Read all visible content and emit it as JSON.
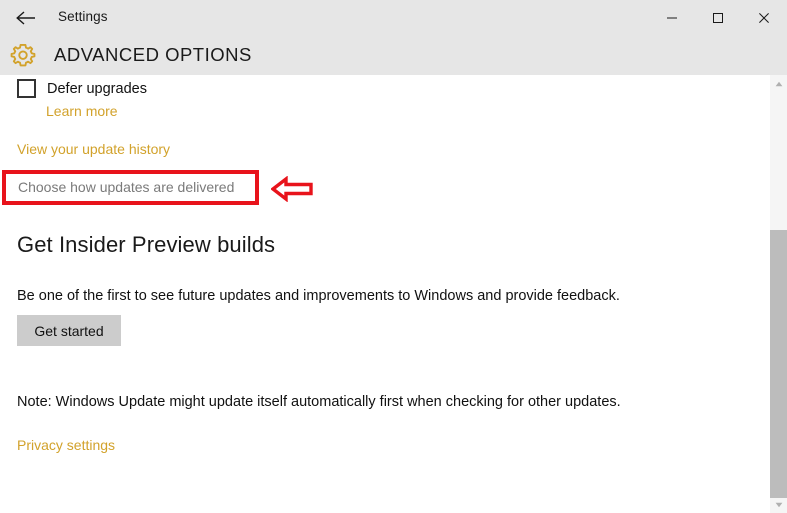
{
  "window": {
    "title": "Settings",
    "back_icon": "back-arrow-icon",
    "controls": {
      "minimize": "minimize-icon",
      "maximize": "maximize-icon",
      "close": "close-icon"
    }
  },
  "page": {
    "icon": "gear-icon",
    "heading": "ADVANCED OPTIONS"
  },
  "content": {
    "defer_upgrades": {
      "label": "Defer upgrades",
      "checked": false,
      "learn_more": "Learn more"
    },
    "update_history_link": "View your update history",
    "highlighted_link": "Choose how updates are delivered",
    "insider": {
      "heading": "Get Insider Preview builds",
      "description": "Be one of the first to see future updates and improvements to Windows and provide feedback.",
      "button": "Get started"
    },
    "note": "Note: Windows Update might update itself automatically first when checking for other updates.",
    "privacy_link": "Privacy settings"
  },
  "annotation": {
    "box_color": "#e8131b",
    "arrow_icon": "left-arrow-annotation-icon",
    "arrow_color": "#e8131b"
  },
  "scrollbar": {
    "up_arrow_icon": "scroll-up-arrow-icon",
    "down_arrow_icon": "scroll-down-arrow-icon",
    "thumb_color": "#bcbcbc",
    "track_color": "#f5f5f5"
  },
  "colors": {
    "chrome_bg": "#e6e6e6",
    "content_bg": "#ffffff",
    "link": "#d2a22b",
    "button_bg": "#cccccc",
    "text": "#111111",
    "muted_text": "#7a7a7a"
  }
}
